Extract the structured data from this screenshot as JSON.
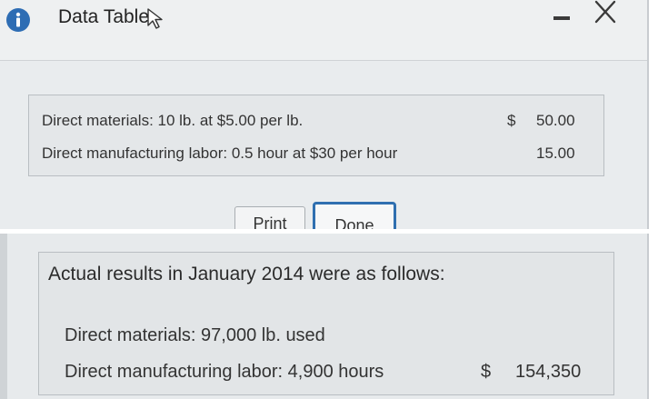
{
  "window": {
    "title": "Data Table",
    "icons": {
      "info": "info-icon",
      "cursor": "cursor-icon",
      "minimize": "minimize-icon",
      "close": "close-icon"
    },
    "accent_color": "#2f6fb0"
  },
  "data_table": {
    "rows": [
      {
        "label": "Direct materials: 10 lb. at $5.00 per lb.",
        "currency": "$",
        "amount": "50.00"
      },
      {
        "label": "Direct manufacturing labor: 0.5 hour at $30 per hour",
        "currency": "",
        "amount": "15.00"
      }
    ]
  },
  "buttons": {
    "print_label": "Print",
    "done_label": "Done"
  },
  "actual_results": {
    "heading": "Actual results in January 2014 were as follows:",
    "rows": [
      {
        "label": "Direct materials: 97,000 lb. used",
        "currency": "",
        "amount": ""
      },
      {
        "label": "Direct manufacturing labor: 4,900 hours",
        "currency": "$",
        "amount": "154,350"
      }
    ]
  }
}
